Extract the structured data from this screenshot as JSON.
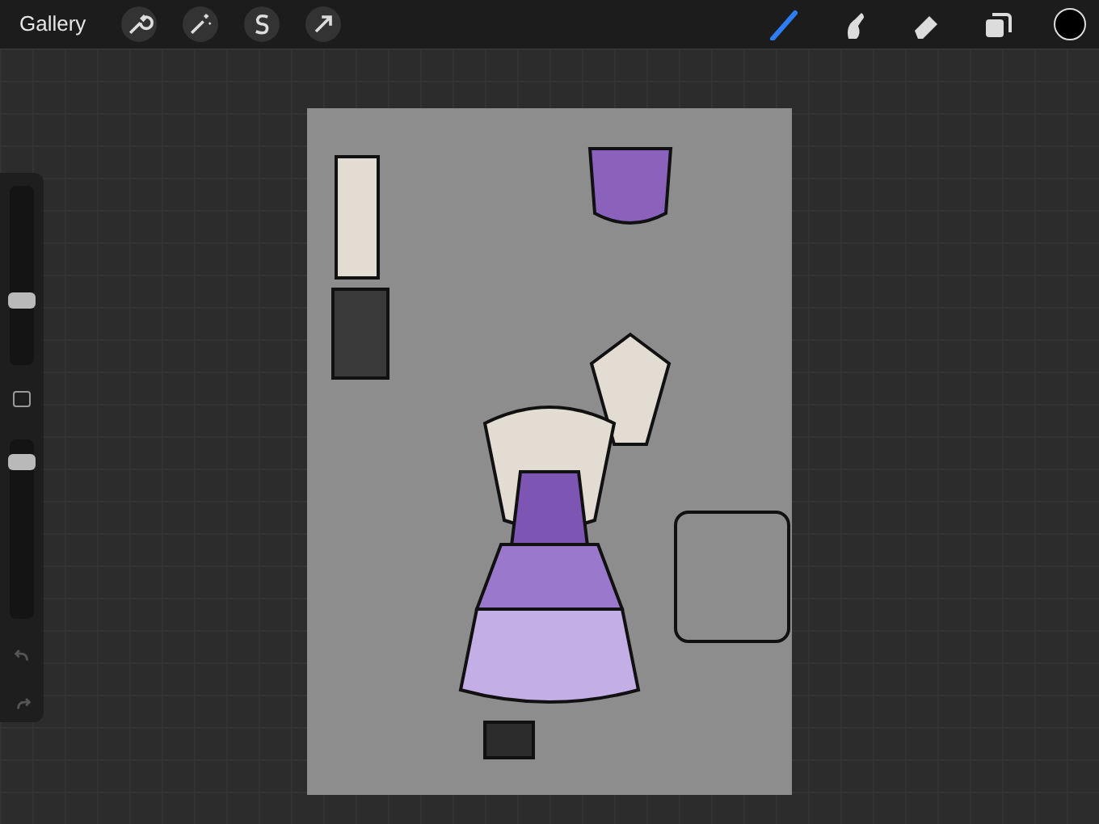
{
  "top_bar": {
    "gallery": "Gallery",
    "actions": [
      {
        "kind": "wrench"
      },
      {
        "kind": "wand"
      },
      {
        "kind": "selection"
      },
      {
        "kind": "transform"
      }
    ],
    "tools": [
      {
        "kind": "brush",
        "selected": true
      },
      {
        "kind": "smudge",
        "selected": false
      },
      {
        "kind": "eraser",
        "selected": false
      },
      {
        "kind": "layers",
        "selected": false
      }
    ],
    "color": "#000000"
  },
  "sidebar": {
    "sliders": [
      {
        "level": 0.35
      },
      {
        "level": 0.92
      }
    ],
    "history": [
      {
        "kind": "undo",
        "disabled": true
      },
      {
        "kind": "redo",
        "disabled": true
      }
    ]
  }
}
